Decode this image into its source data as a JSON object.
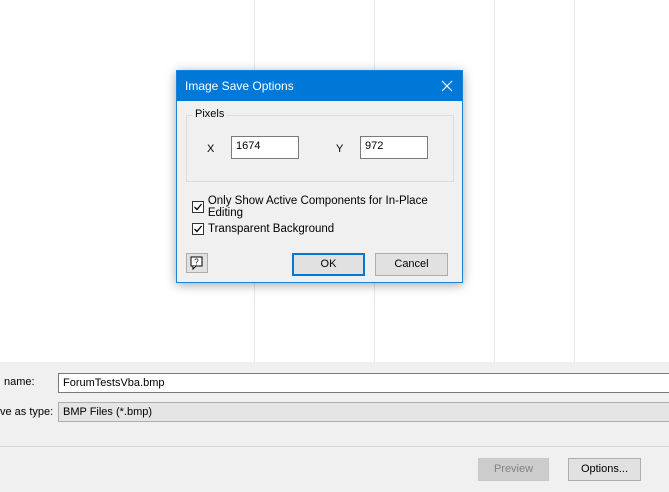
{
  "background": {
    "file_name_label": "name:",
    "file_name_value": "ForumTestsVba.bmp",
    "save_as_type_label": "ve as type:",
    "save_as_type_value": "BMP Files (*.bmp)",
    "preview_button": "Preview",
    "options_button": "Options..."
  },
  "dialog": {
    "title": "Image Save Options",
    "close_icon": "close-icon",
    "pixels_group": {
      "legend": "Pixels",
      "x_label": "X",
      "x_value": "1674",
      "y_label": "Y",
      "y_value": "972"
    },
    "only_active_components": {
      "label": "Only Show Active Components for In-Place Editing",
      "checked": true
    },
    "transparent_background": {
      "label": "Transparent Background",
      "checked": true
    },
    "help_icon": "context-help-icon",
    "ok_button": "OK",
    "cancel_button": "Cancel"
  },
  "colors": {
    "titlebar": "#0078d7",
    "dialog_bg": "#f0f0f0",
    "accent_border": "#0078d7"
  }
}
